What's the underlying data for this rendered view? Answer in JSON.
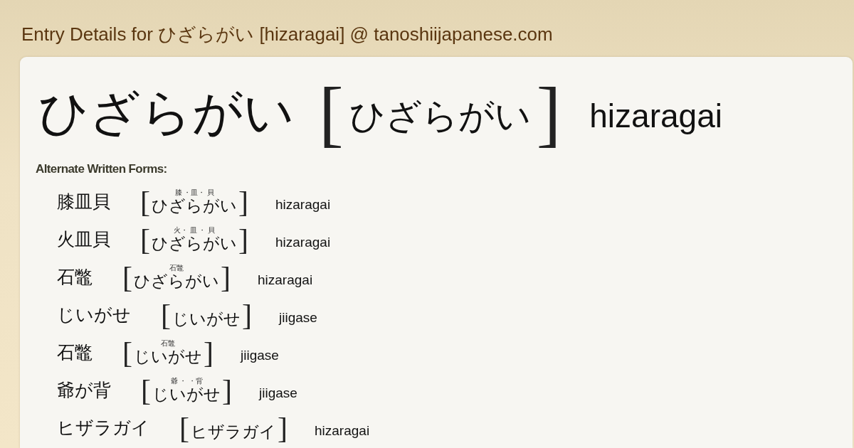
{
  "page_title": "Entry Details for ひざらがい [hizaragai] @ tanoshiijapanese.com",
  "entry": {
    "word": "ひざらがい",
    "open": "[",
    "reading": "ひざらがい",
    "close": "]",
    "romaji": "hizaragai"
  },
  "alternate_forms": {
    "heading": "Alternate Written Forms:",
    "items": [
      {
        "word": "膝皿貝",
        "open": "[",
        "ruby": "膝 ・皿・ 貝",
        "reading": "ひざらがい",
        "close": "]",
        "romaji": "hizaragai"
      },
      {
        "word": "火皿貝",
        "open": "[",
        "ruby": "火・ 皿 ・ 貝",
        "reading": "ひざらがい",
        "close": "]",
        "romaji": "hizaragai"
      },
      {
        "word": "石鼈",
        "open": "[",
        "ruby": "石鼈",
        "reading": "ひざらがい",
        "close": "]",
        "romaji": "hizaragai"
      },
      {
        "word": "じいがせ",
        "open": "[",
        "reading": "じいがせ",
        "close": "]",
        "romaji": "jiigase"
      },
      {
        "word": "石鼈",
        "open": "[",
        "ruby": "石鼈",
        "reading": "じいがせ",
        "close": "]",
        "romaji": "jiigase"
      },
      {
        "word": "爺が背",
        "open": "[",
        "ruby": "爺 ・ ・背",
        "reading": "じいがせ",
        "close": "]",
        "romaji": "jiigase"
      },
      {
        "word": "ヒザラガイ",
        "open": "[",
        "reading": "ヒザラガイ",
        "close": "]",
        "romaji": "hizaragai"
      }
    ]
  }
}
